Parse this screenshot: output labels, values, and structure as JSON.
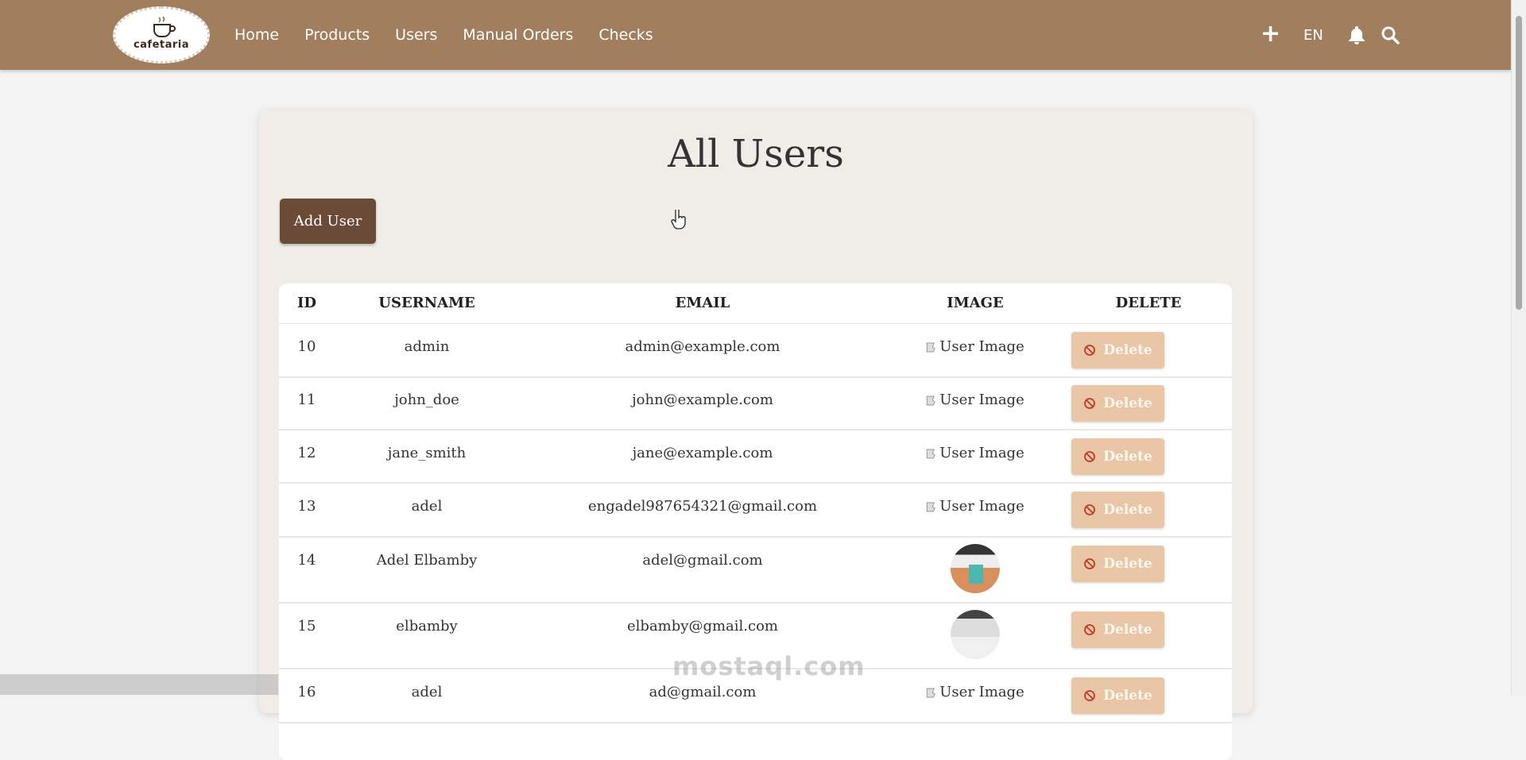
{
  "navbar": {
    "logo_text": "cafetaria",
    "links": [
      "Home",
      "Products",
      "Users",
      "Manual Orders",
      "Checks"
    ],
    "plus_label": "+",
    "language": "EN"
  },
  "page": {
    "title": "All Users",
    "add_button": "Add User"
  },
  "table": {
    "headers": [
      "ID",
      "USERNAME",
      "EMAIL",
      "IMAGE",
      "DELETE"
    ],
    "rows": [
      {
        "id": "10",
        "username": "admin",
        "email": "admin@example.com",
        "image": "User Image",
        "delete": "Delete"
      },
      {
        "id": "11",
        "username": "john_doe",
        "email": "john@example.com",
        "image": "User Image",
        "delete": "Delete"
      },
      {
        "id": "12",
        "username": "jane_smith",
        "email": "jane@example.com",
        "image": "User Image",
        "delete": "Delete"
      },
      {
        "id": "13",
        "username": "adel",
        "email": "engadel987654321@gmail.com",
        "image": "User Image",
        "delete": "Delete"
      },
      {
        "id": "14",
        "username": "Adel Elbamby",
        "email": "adel@gmail.com",
        "image": "",
        "delete": "Delete"
      },
      {
        "id": "15",
        "username": "elbamby",
        "email": "elbamby@gmail.com",
        "image": "",
        "delete": "Delete"
      },
      {
        "id": "16",
        "username": "adel",
        "email": "ad@gmail.com",
        "image": "User Image",
        "delete": "Delete"
      }
    ]
  },
  "watermark": "mostaql.com",
  "colors": {
    "navbar": "#a07e5e",
    "add_button": "#6b4a38",
    "delete_button": "#e8c6a6"
  }
}
